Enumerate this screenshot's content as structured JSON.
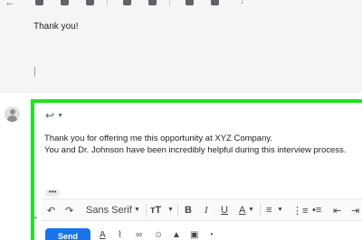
{
  "message": {
    "previous_text": "Thank you!"
  },
  "compose": {
    "reply_icon": "reply-icon",
    "reply_menu_icon": "chevron-down-icon",
    "lines": [
      "Thank you for offering me this opportunity at XYZ Company.",
      "You and Dr. Johnson have been incredibly helpful during this interview process."
    ],
    "quoted_toggle": "•••",
    "send_label": "Send"
  },
  "formatting": {
    "font_family": "Sans Serif",
    "bold": "B",
    "italic": "I",
    "underline": "U",
    "text_color": "A"
  },
  "colors": {
    "highlight": "#22e022",
    "send": "#1a73e8"
  }
}
